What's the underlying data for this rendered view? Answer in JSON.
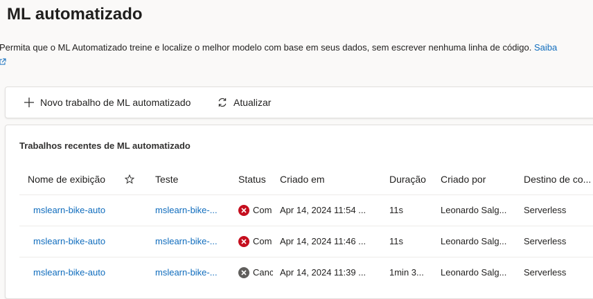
{
  "header": {
    "title": "ML automatizado",
    "description": "Permita que o ML Automatizado treine e localize o melhor modelo com base em seus dados, sem escrever nenhuma linha de código.",
    "learn_more": "Saiba"
  },
  "toolbar": {
    "new_job_label": "Novo trabalho de ML automatizado",
    "refresh_label": "Atualizar"
  },
  "recent": {
    "section_title": "Trabalhos recentes de ML automatizado",
    "columns": {
      "display_name": "Nome de exibição",
      "experiment": "Teste",
      "status": "Status",
      "created_on": "Criado em",
      "duration": "Duração",
      "created_by": "Criado por",
      "compute_target": "Destino de co..."
    },
    "rows": [
      {
        "display_name": "mslearn-bike-auto",
        "experiment": "mslearn-bike-...",
        "status": "Com",
        "status_kind": "failed",
        "created_on": "Apr 14, 2024 11:54 ...",
        "duration": "11s",
        "created_by": "Leonardo Salg...",
        "compute_target": "Serverless"
      },
      {
        "display_name": "mslearn-bike-auto",
        "experiment": "mslearn-bike-...",
        "status": "Com",
        "status_kind": "failed",
        "created_on": "Apr 14, 2024 11:46 ...",
        "duration": "11s",
        "created_by": "Leonardo Salg...",
        "compute_target": "Serverless"
      },
      {
        "display_name": "mslearn-bike-auto",
        "experiment": "mslearn-bike-...",
        "status": "Canc",
        "status_kind": "canceled",
        "created_on": "Apr 14, 2024 11:39 ...",
        "duration": "1min 3...",
        "created_by": "Leonardo Salg...",
        "compute_target": "Serverless"
      }
    ]
  },
  "colors": {
    "link": "#0f6cbd",
    "failed": "#c50f1f",
    "canceled": "#605e5c"
  }
}
